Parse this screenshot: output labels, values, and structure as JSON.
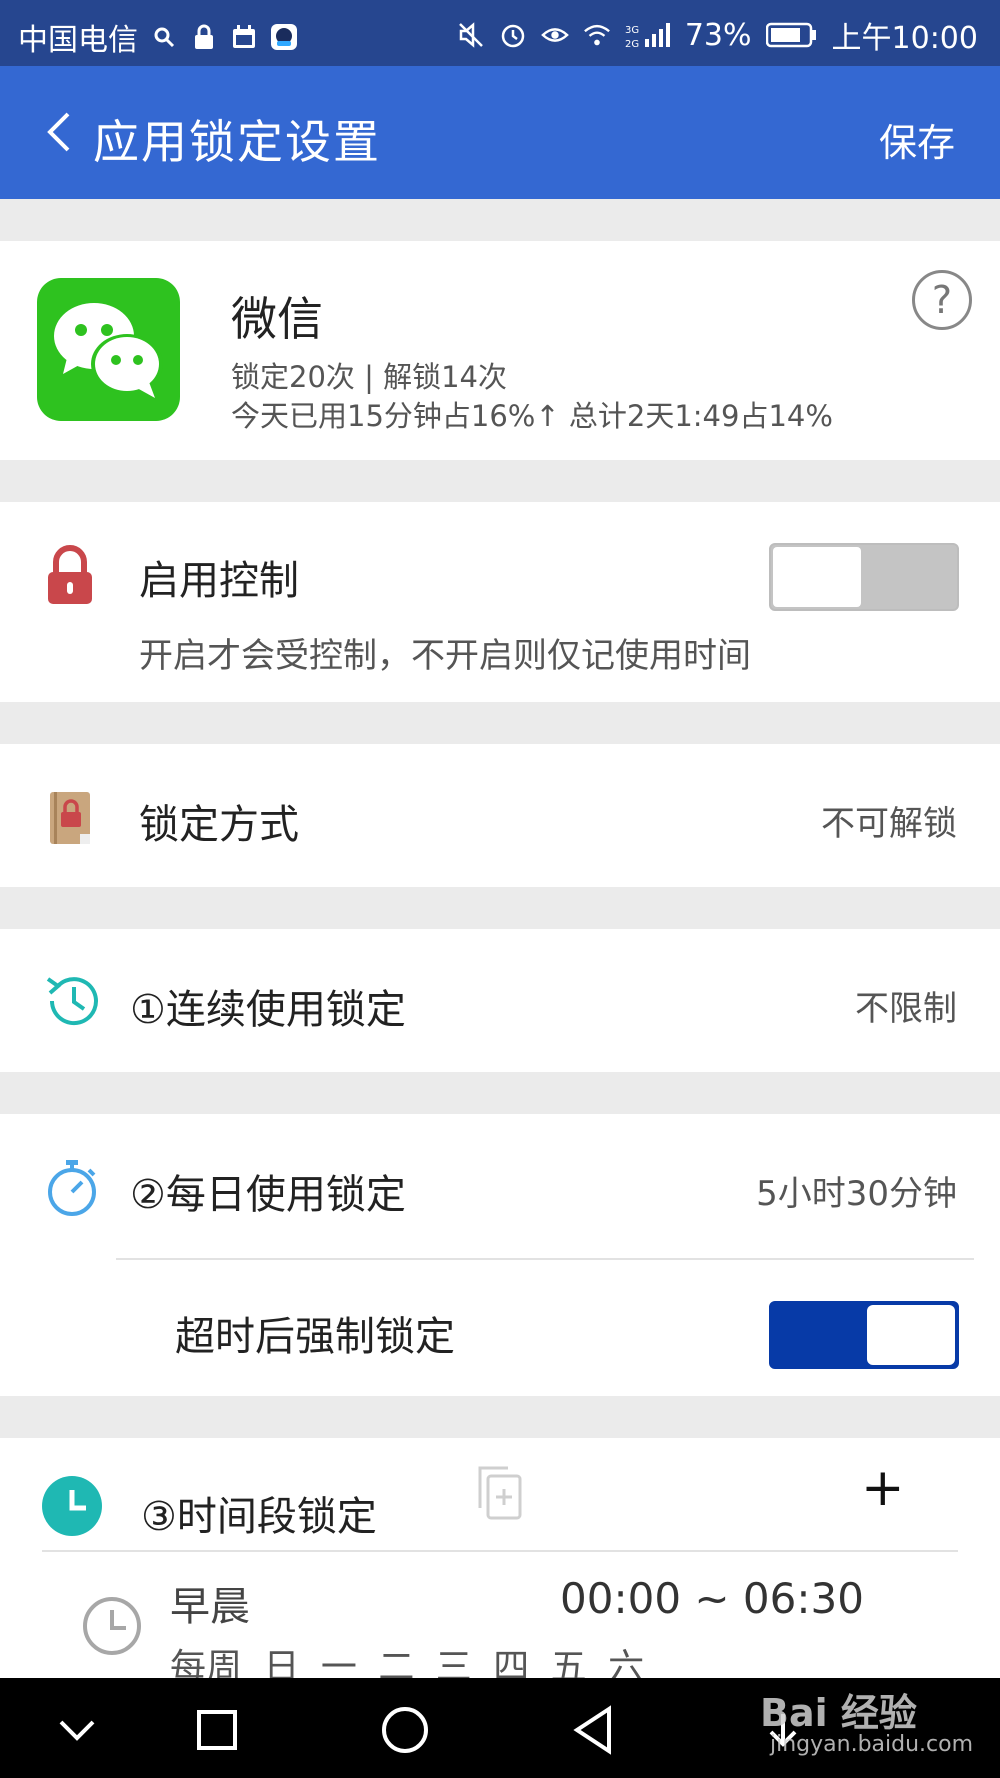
{
  "status_bar": {
    "carrier": "中国电信",
    "battery": "73%",
    "time": "上午10:00",
    "network": "3G 2G"
  },
  "header": {
    "title": "应用锁定设置",
    "save_label": "保存"
  },
  "app": {
    "name": "微信",
    "stat_line1": "锁定20次 | 解锁14次",
    "stat_line2": "今天已用15分钟占16%↑ 总计2天1:49占14%"
  },
  "enable_control": {
    "label": "启用控制",
    "description": "开启才会受控制，不开启则仅记使用时间",
    "enabled": false
  },
  "lock_mode": {
    "label": "锁定方式",
    "value": "不可解锁"
  },
  "continuous_lock": {
    "label": "①连续使用锁定",
    "value": "不限制"
  },
  "daily_lock": {
    "label": "②每日使用锁定",
    "value": "5小时30分钟",
    "force_label": "超时后强制锁定",
    "force_enabled": true
  },
  "period_lock": {
    "label": "③时间段锁定",
    "add_label": "+",
    "entries": [
      {
        "name": "早晨",
        "range": "00:00 ~ 06:30",
        "days": "每周 日 一 二 三 四 五 六"
      }
    ]
  },
  "watermark": {
    "brand": "Bai 经验",
    "url": "jingyan.baidu.com"
  },
  "colors": {
    "status_bar": "#26468f",
    "app_bar": "#3468d2",
    "toggle_on": "#073aa7",
    "toggle_off": "#c4c4c4",
    "accent_teal": "#1fb8b3",
    "wechat_green": "#2ec21f"
  }
}
